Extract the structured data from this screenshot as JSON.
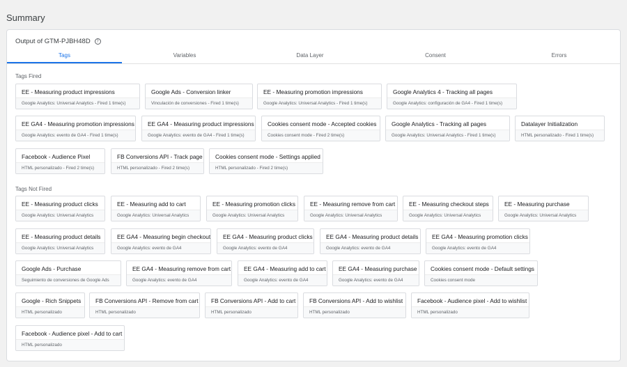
{
  "page": {
    "title": "Summary"
  },
  "panel": {
    "title": "Output of GTM-PJBH48D"
  },
  "tabs": [
    {
      "label": "Tags",
      "active": true
    },
    {
      "label": "Variables",
      "active": false
    },
    {
      "label": "Data Layer",
      "active": false
    },
    {
      "label": "Consent",
      "active": false
    },
    {
      "label": "Errors",
      "active": false
    }
  ],
  "sections": {
    "fired": {
      "label": "Tags Fired"
    },
    "not_fired": {
      "label": "Tags Not Fired"
    }
  },
  "tags_fired": [
    {
      "name": "EE - Measuring product impressions",
      "detail": "Google Analytics: Universal Analytics - Fired 1 time(s)"
    },
    {
      "name": "Google Ads - Conversion linker",
      "detail": "Vinculación de conversiones - Fired 1 time(s)"
    },
    {
      "name": "EE - Measuring promotion impressions",
      "detail": "Google Analytics: Universal Analytics - Fired 1 time(s)"
    },
    {
      "name": "Google Analytics 4 - Tracking all pages",
      "detail": "Google Analytics: configuración de GA4 - Fired 1 time(s)"
    },
    {
      "name": "EE GA4 - Measuring promotion impressions",
      "detail": "Google Analytics: evento de GA4 - Fired 1 time(s)"
    },
    {
      "name": "EE GA4 - Measuring product impressions",
      "detail": "Google Analytics: evento de GA4 - Fired 1 time(s)"
    },
    {
      "name": "Cookies consent mode - Accepted cookies",
      "detail": "Cookies consent mode - Fired 2 time(s)"
    },
    {
      "name": "Google Analytics - Tracking all pages",
      "detail": "Google Analytics: Universal Analytics - Fired 1 time(s)"
    },
    {
      "name": "Datalayer Initialization",
      "detail": "HTML personalizado - Fired 1 time(s)"
    },
    {
      "name": "Facebook - Audience Pixel",
      "detail": "HTML personalizado - Fired 2 time(s)"
    },
    {
      "name": "FB Conversions API - Track page",
      "detail": "HTML personalizado - Fired 2 time(s)"
    },
    {
      "name": "Cookies consent mode - Settings applied",
      "detail": "HTML personalizado - Fired 2 time(s)"
    }
  ],
  "tags_not_fired": [
    {
      "name": "EE - Measuring product clicks",
      "detail": "Google Analytics: Universal Analytics"
    },
    {
      "name": "EE - Measuring add to cart",
      "detail": "Google Analytics: Universal Analytics"
    },
    {
      "name": "EE - Measuring promotion clicks",
      "detail": "Google Analytics: Universal Analytics"
    },
    {
      "name": "EE - Measuring remove from cart",
      "detail": "Google Analytics: Universal Analytics"
    },
    {
      "name": "EE - Measuring checkout steps",
      "detail": "Google Analytics: Universal Analytics"
    },
    {
      "name": "EE - Measuring purchase",
      "detail": "Google Analytics: Universal Analytics"
    },
    {
      "name": "EE - Measuring product details",
      "detail": "Google Analytics: Universal Analytics"
    },
    {
      "name": "EE GA4 - Measuring begin checkout",
      "detail": "Google Analytics: evento de GA4"
    },
    {
      "name": "EE GA4 - Measuring product clicks",
      "detail": "Google Analytics: evento de GA4"
    },
    {
      "name": "EE GA4 - Measuring product details",
      "detail": "Google Analytics: evento de GA4"
    },
    {
      "name": "EE GA4 - Measuring promotion clicks",
      "detail": "Google Analytics: evento de GA4"
    },
    {
      "name": "Google Ads - Purchase",
      "detail": "Seguimiento de conversiones de Google Ads"
    },
    {
      "name": "EE GA4 - Measuring remove from cart",
      "detail": "Google Analytics: evento de GA4"
    },
    {
      "name": "EE GA4 - Measuring add to cart",
      "detail": "Google Analytics: evento de GA4"
    },
    {
      "name": "EE GA4 - Measuring purchase",
      "detail": "Google Analytics: evento de GA4"
    },
    {
      "name": "Cookies consent mode - Default settings",
      "detail": "Cookies consent mode"
    },
    {
      "name": "Google - Rich Snippets",
      "detail": "HTML personalizado"
    },
    {
      "name": "FB Conversions API - Remove from cart",
      "detail": "HTML personalizado"
    },
    {
      "name": "FB Conversions API - Add to cart",
      "detail": "HTML personalizado"
    },
    {
      "name": "FB Conversions API - Add to wishlist",
      "detail": "HTML personalizado"
    },
    {
      "name": "Facebook - Audience pixel - Add to wishlist",
      "detail": "HTML personalizado"
    },
    {
      "name": "Facebook - Audience pixel - Add to cart",
      "detail": "HTML personalizado"
    }
  ],
  "colors": {
    "accent": "#1a73e8",
    "page_bg": "#f1f1f1",
    "card_border": "#dadce0",
    "subtext": "#5f6368"
  },
  "icons": {
    "help": "help-circle-icon"
  }
}
